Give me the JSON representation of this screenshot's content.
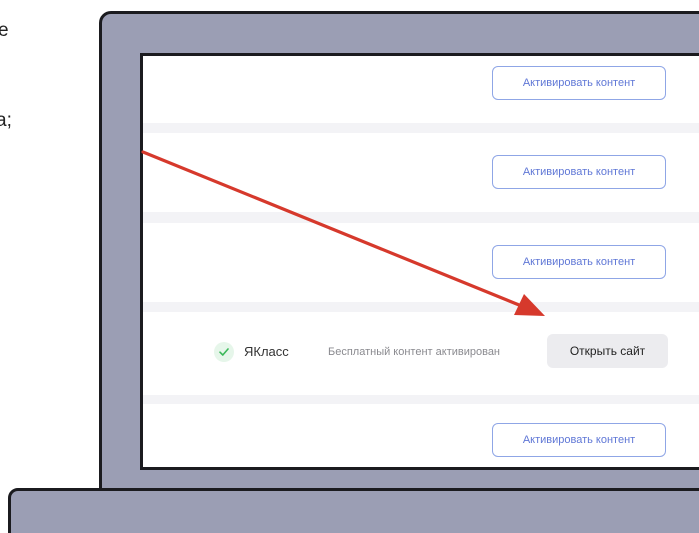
{
  "side_text": {
    "line1": "е",
    "line2": "а;"
  },
  "rows": [
    {
      "button_label": "Активировать контент"
    },
    {
      "button_label": "Активировать контент"
    },
    {
      "button_label": "Активировать контент"
    },
    {
      "service_name": "ЯКласс",
      "status": "Бесплатный контент активирован",
      "open_label": "Открыть сайт",
      "check_color": "#3bb85a"
    },
    {
      "button_label": "Активировать контент"
    }
  ],
  "colors": {
    "laptop_body": "#9b9eb4",
    "arrow": "#d6392c",
    "accent": "#5f77d6",
    "check_bg": "#e6f6ea"
  },
  "icons": {
    "status": "check-icon",
    "annotation": "arrow-icon"
  }
}
